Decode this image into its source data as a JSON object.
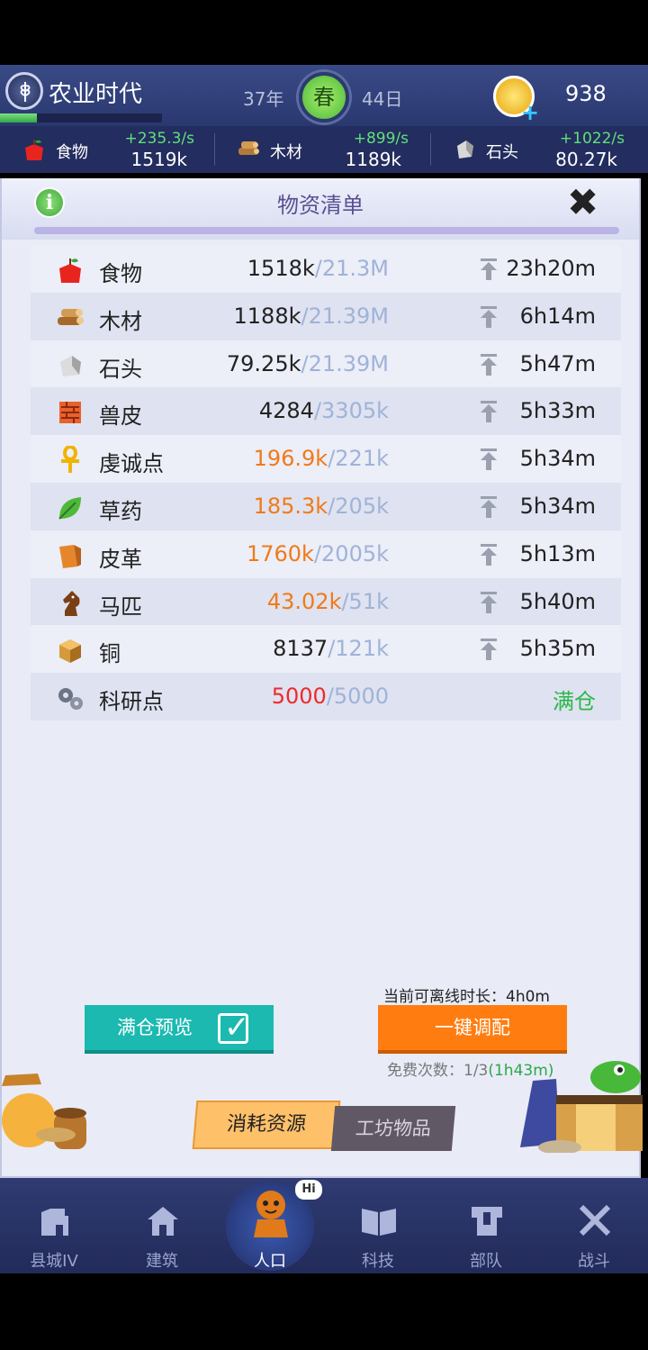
{
  "header": {
    "era_title": "农业时代",
    "era_progress": 0.23,
    "year": "37年",
    "season": "春",
    "day": "44日",
    "coins": "938"
  },
  "resource_bar": [
    {
      "name": "食物",
      "rate": "+235.3/s",
      "amount": "1519k",
      "icon": "apple-icon"
    },
    {
      "name": "木材",
      "rate": "+899/s",
      "amount": "1189k",
      "icon": "wood-logs-icon"
    },
    {
      "name": "石头",
      "rate": "+1022/s",
      "amount": "80.27k",
      "icon": "stone-icon"
    }
  ],
  "panel": {
    "title": "物资清单",
    "info_icon": "i",
    "close_icon": "✖"
  },
  "items": [
    {
      "name": "食物",
      "current": "1518k",
      "cap": "/21.3M",
      "time": "23h20m",
      "icon": "apple-icon",
      "state": "normal"
    },
    {
      "name": "木材",
      "current": "1188k",
      "cap": "/21.39M",
      "time": "6h14m",
      "icon": "wood-logs-icon",
      "state": "normal"
    },
    {
      "name": "石头",
      "current": "79.25k",
      "cap": "/21.39M",
      "time": "5h47m",
      "icon": "stone-icon",
      "state": "normal"
    },
    {
      "name": "兽皮",
      "current": "4284",
      "cap": "/3305k",
      "time": "5h33m",
      "icon": "hide-icon",
      "state": "normal"
    },
    {
      "name": "虔诚点",
      "current": "196.9k",
      "cap": "/221k",
      "time": "5h34m",
      "icon": "ankh-icon",
      "state": "warn"
    },
    {
      "name": "草药",
      "current": "185.3k",
      "cap": "/205k",
      "time": "5h34m",
      "icon": "leaf-icon",
      "state": "warn"
    },
    {
      "name": "皮革",
      "current": "1760k",
      "cap": "/2005k",
      "time": "5h13m",
      "icon": "leather-icon",
      "state": "warn"
    },
    {
      "name": "马匹",
      "current": "43.02k",
      "cap": "/51k",
      "time": "5h40m",
      "icon": "horse-icon",
      "state": "warn"
    },
    {
      "name": "铜",
      "current": "8137",
      "cap": "/121k",
      "time": "5h35m",
      "icon": "copper-icon",
      "state": "normal"
    },
    {
      "name": "科研点",
      "current": "5000",
      "cap": "/5000",
      "time": "满仓",
      "icon": "gears-icon",
      "state": "full"
    }
  ],
  "offline_time": "当前可离线时长：4h0m",
  "buttons": {
    "preview": "满仓预览",
    "allocate": "一键调配",
    "free_count": "免费次数：1/3",
    "free_timer": "(1h43m)"
  },
  "tabs": {
    "active": "消耗资源",
    "inactive": "工坊物品"
  },
  "nav": [
    {
      "label": "县城IV",
      "icon": "castle-icon"
    },
    {
      "label": "建筑",
      "icon": "house-icon"
    },
    {
      "label": "人口",
      "icon": "person-icon",
      "badge": "Hi"
    },
    {
      "label": "科技",
      "icon": "book-icon"
    },
    {
      "label": "部队",
      "icon": "armor-icon"
    },
    {
      "label": "战斗",
      "icon": "swords-icon"
    }
  ],
  "colors": {
    "accent_orange": "#ff7d10",
    "teal": "#1bb9b0",
    "warn_orange": "#f07a18",
    "full_red": "#ee2a2a",
    "green": "#2ab84a"
  }
}
